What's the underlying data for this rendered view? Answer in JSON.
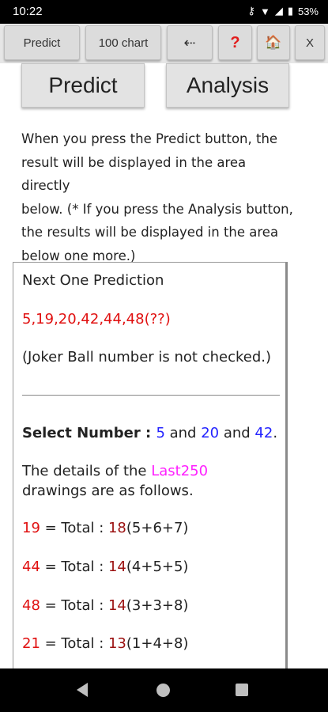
{
  "status": {
    "time": "10:22",
    "icons": [
      "key-icon",
      "wifi-icon",
      "signal-icon",
      "battery-icon"
    ],
    "battery": "53%"
  },
  "toolbar": {
    "predict": "Predict",
    "chart": "100 chart",
    "back": "⇠",
    "help": "?",
    "home": "🏠",
    "close": "X"
  },
  "buttons": {
    "predict": "Predict",
    "analysis": "Analysis"
  },
  "description": {
    "lines": [
      "When you press the Predict button, the",
      "result will be displayed in the area directly",
      "below. (* If you press the Analysis button,",
      "the results will be displayed in the area",
      "below one more.)"
    ]
  },
  "result": {
    "heading": "Next One Prediction",
    "numbers": "5,19,20,42,44,48(??)",
    "joker_note": "(Joker Ball number is not checked.)",
    "select_label": "Select Number : ",
    "select_n1": "5",
    "select_and1": " and ",
    "select_n2": "20",
    "select_and2": " and ",
    "select_n3": "42",
    "select_end": ".",
    "details_prefix": "The details of the ",
    "details_highlight": "Last250",
    "details_suffix": "drawings are as follows.",
    "totals": [
      {
        "num": "19",
        "mid": " = Total : ",
        "total": "18",
        "breakdown": "(5+6+7)"
      },
      {
        "num": "44",
        "mid": " = Total : ",
        "total": "14",
        "breakdown": "(4+5+5)"
      },
      {
        "num": "48",
        "mid": " = Total : ",
        "total": "14",
        "breakdown": "(3+3+8)"
      },
      {
        "num": "21",
        "mid": " = Total : ",
        "total": "13",
        "breakdown": "(1+4+8)"
      }
    ]
  },
  "colors": {
    "highlight_red": "#e01010",
    "select_blue": "#2323ff",
    "last_magenta": "#ff1fff",
    "total_darkred": "#9b1111"
  }
}
